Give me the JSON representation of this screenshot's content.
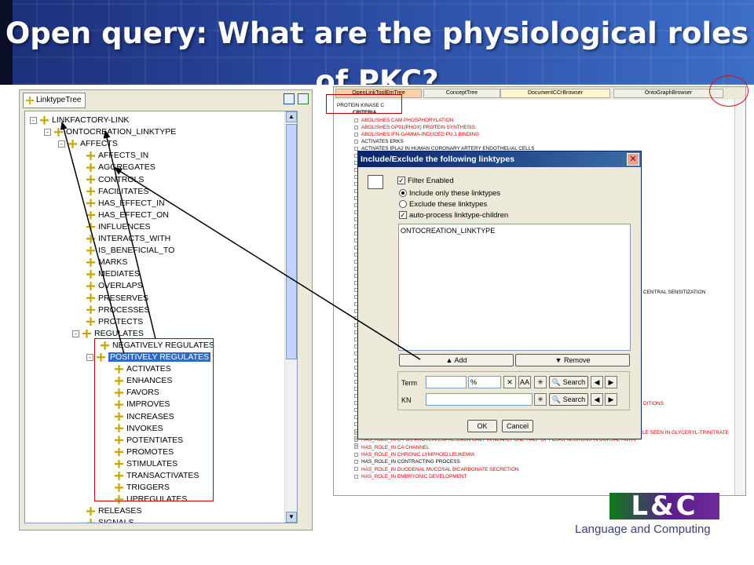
{
  "slide": {
    "title": "Open query: What are the physiological roles of PKC?"
  },
  "left_panel": {
    "tab_label": "LinktypeTree",
    "nodes": [
      {
        "label": "LINKFACTORY-LINK",
        "exp": "-"
      },
      {
        "label": "ONTOCREATION_LINKTYPE",
        "exp": "-"
      },
      {
        "label": "AFFECTS",
        "exp": "-"
      },
      {
        "label": "AFFECTS_IN"
      },
      {
        "label": "AGGREGATES"
      },
      {
        "label": "CONTROLS"
      },
      {
        "label": "FACILITATES"
      },
      {
        "label": "HAS_EFFECT_IN"
      },
      {
        "label": "HAS_EFFECT_ON"
      },
      {
        "label": "INFLUENCES"
      },
      {
        "label": "INTERACTS_WITH"
      },
      {
        "label": "IS_BENEFICIAL_TO"
      },
      {
        "label": "MARKS"
      },
      {
        "label": "MEDIATES"
      },
      {
        "label": "OVERLAPS"
      },
      {
        "label": "PRESERVES"
      },
      {
        "label": "PROCESSES"
      },
      {
        "label": "PROTECTS"
      },
      {
        "label": "REGULATES",
        "exp": "-"
      },
      {
        "label": "NEGATIVELY REGULATES"
      },
      {
        "label": "POSITIVELY REGULATES",
        "exp": "-"
      },
      {
        "label": "ACTIVATES"
      },
      {
        "label": "ENHANCES"
      },
      {
        "label": "FAVORS"
      },
      {
        "label": "IMPROVES"
      },
      {
        "label": "INCREASES"
      },
      {
        "label": "INVOKES"
      },
      {
        "label": "POTENTIATES"
      },
      {
        "label": "PROMOTES"
      },
      {
        "label": "STIMULATES"
      },
      {
        "label": "TRANSACTIVATES"
      },
      {
        "label": "TRIGGERS"
      },
      {
        "label": "UPREGULATES"
      },
      {
        "label": "RELEASES"
      },
      {
        "label": "SIGNALS"
      }
    ]
  },
  "right_panel": {
    "tabs": [
      "OpenLinkToolEmTree",
      "ConceptTree",
      "DocumentCCrBrowser",
      "OntoGraphBrowser"
    ],
    "root": "PROTEIN KINASE C",
    "criteria": "CRITERIA",
    "rows_top": [
      {
        "text": "ABOLISHES CAM PHOSPHORYLATION"
      },
      {
        "text": "ABOLISHES GP91(PHOX) PROTEIN SYNTHESIS"
      },
      {
        "text": "ABOLISHES IFN-GAMMA-INDUCED PU.1 BINDING"
      },
      {
        "text": "ACTIVATES ERKS",
        "black": true
      },
      {
        "text": "ACTIVATES IPLA2 IN HUMAN CORONARY ARTERY ENDOTHELIAL CELLS",
        "black": true
      }
    ],
    "row_mid1": "CENTRAL SENSITIZATION",
    "row_mid2": "DITIONS",
    "rows_bottom": [
      {
        "text": "HAS_ROLE_IN ATTENUATION OF CGMP-MEDIATED RELAXATION OF SKINNED RESISTANCE ARTERY SMOOTH MUSCLE SEEN IN GLYCERYL-TRINITRATE"
      },
      {
        "text": "HAS_ROLE_IN C-FOS PROTEIN EXPRESSION ONLY IN NEARLY ONE HALF OF FOS-LI NEURONS IN DORSAL HORN"
      },
      {
        "text": "HAS_ROLE_IN CA CHANNEL"
      },
      {
        "text": "HAS_ROLE_IN CHRONIC LYMPHOID LEUKEMIA"
      },
      {
        "text": "HAS_ROLE_IN CONTRACTING PROCESS",
        "black": true
      },
      {
        "text": "HAS_ROLE_IN DUODENAL MUCOSAL BICARBONATE SECRETION"
      },
      {
        "text": "HAS_ROLE_IN EMBRYONIC DEVELOPMENT"
      }
    ]
  },
  "dialog": {
    "title": "Include/Exclude the following linktypes",
    "filter_enabled": "Filter Enabled",
    "include_only": "Include only these linktypes",
    "exclude": "Exclude these linktypes",
    "auto_process": "auto-process linktype-children",
    "list_items": [
      "ONTOCREATION_LINKTYPE"
    ],
    "add": "Add",
    "remove": "Remove",
    "term_label": "Term",
    "term_value": "%",
    "kn_label": "KN",
    "aa": "AA",
    "search": "Search",
    "ok": "OK",
    "cancel": "Cancel"
  },
  "logo": {
    "letters": "L&C",
    "company": "Language and Computing"
  }
}
